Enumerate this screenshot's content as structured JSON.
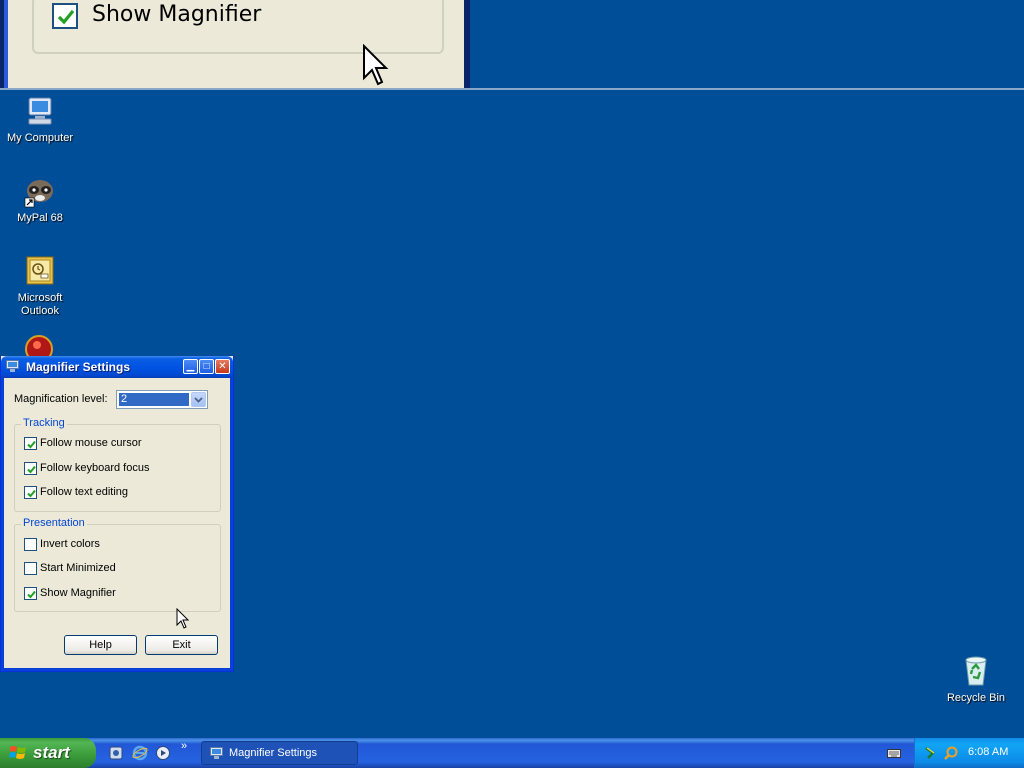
{
  "magnifier_view": {
    "checkbox_label": "Show Magnifier",
    "checked": true
  },
  "desktop": {
    "icons": [
      {
        "label": "My Computer",
        "icon": "computer-icon"
      },
      {
        "label": "MyPal 68",
        "icon": "mypal-raccoon-icon"
      },
      {
        "label": "Microsoft Outlook",
        "icon": "outlook-icon"
      },
      {
        "label": "Recycle Bin",
        "icon": "recycle-bin-icon"
      }
    ]
  },
  "window": {
    "title": "Magnifier Settings",
    "magnification_label": "Magnification level:",
    "magnification_value": "2",
    "tracking": {
      "title": "Tracking",
      "options": [
        {
          "label": "Follow mouse cursor",
          "checked": true
        },
        {
          "label": "Follow keyboard focus",
          "checked": true
        },
        {
          "label": "Follow text editing",
          "checked": true
        }
      ]
    },
    "presentation": {
      "title": "Presentation",
      "options": [
        {
          "label": "Invert colors",
          "checked": false
        },
        {
          "label": "Start Minimized",
          "checked": false
        },
        {
          "label": "Show Magnifier",
          "checked": true
        }
      ]
    },
    "buttons": {
      "help": "Help",
      "exit": "Exit"
    }
  },
  "taskbar": {
    "start_label": "start",
    "quick_launch": [
      "media-icon",
      "internet-explorer-icon",
      "media-player-icon"
    ],
    "task_button": "Magnifier Settings",
    "clock": "6:08 AM"
  },
  "colors": {
    "desktop": "#004e98",
    "title_bar": "#0054e3",
    "group_title": "#0046d5",
    "start_button": "#3a9a3a"
  }
}
